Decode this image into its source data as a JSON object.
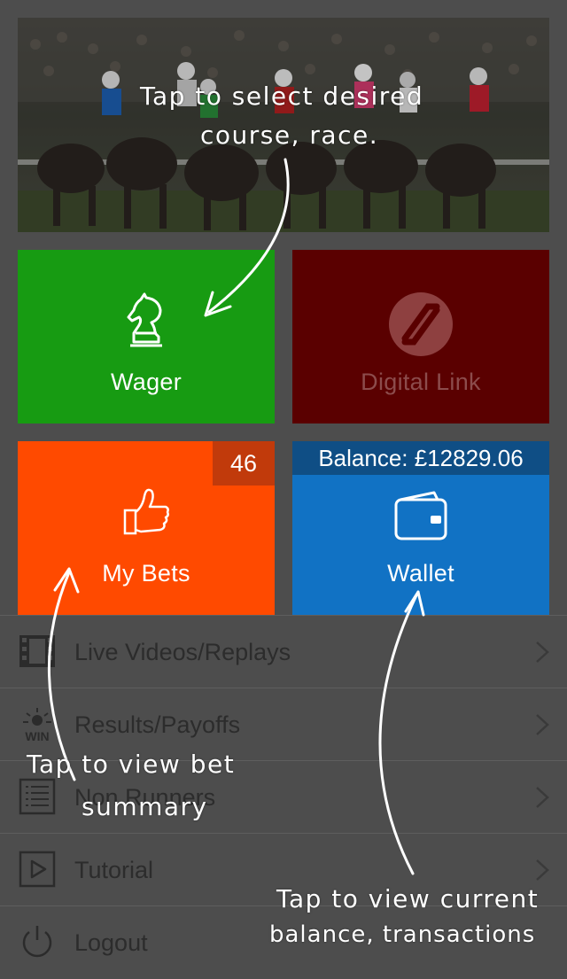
{
  "tiles": {
    "wager": {
      "label": "Wager",
      "color": "#179b12"
    },
    "digital_link": {
      "label": "Digital Link",
      "color": "#5a0000"
    },
    "my_bets": {
      "label": "My Bets",
      "count": "46",
      "color": "#ff4a00"
    },
    "wallet": {
      "label": "Wallet",
      "balance": "Balance: £12829.06",
      "color": "#1172c4"
    }
  },
  "menu": {
    "items": [
      {
        "label": "Live Videos/Replays",
        "icon": "film-icon"
      },
      {
        "label": "Results/Payoffs",
        "icon": "win-icon"
      },
      {
        "label": "Non Runners",
        "icon": "list-icon"
      },
      {
        "label": "Tutorial",
        "icon": "play-icon"
      },
      {
        "label": "Logout",
        "icon": "power-icon"
      }
    ]
  },
  "overlay_notes": {
    "banner_note_line1": "Tap to select desired",
    "banner_note_line2": "course, race.",
    "bets_note_line1": "Tap to view bet",
    "bets_note_line2": "summary",
    "wallet_note_line1": "Tap to view current",
    "wallet_note_line2": "balance, transactions"
  }
}
